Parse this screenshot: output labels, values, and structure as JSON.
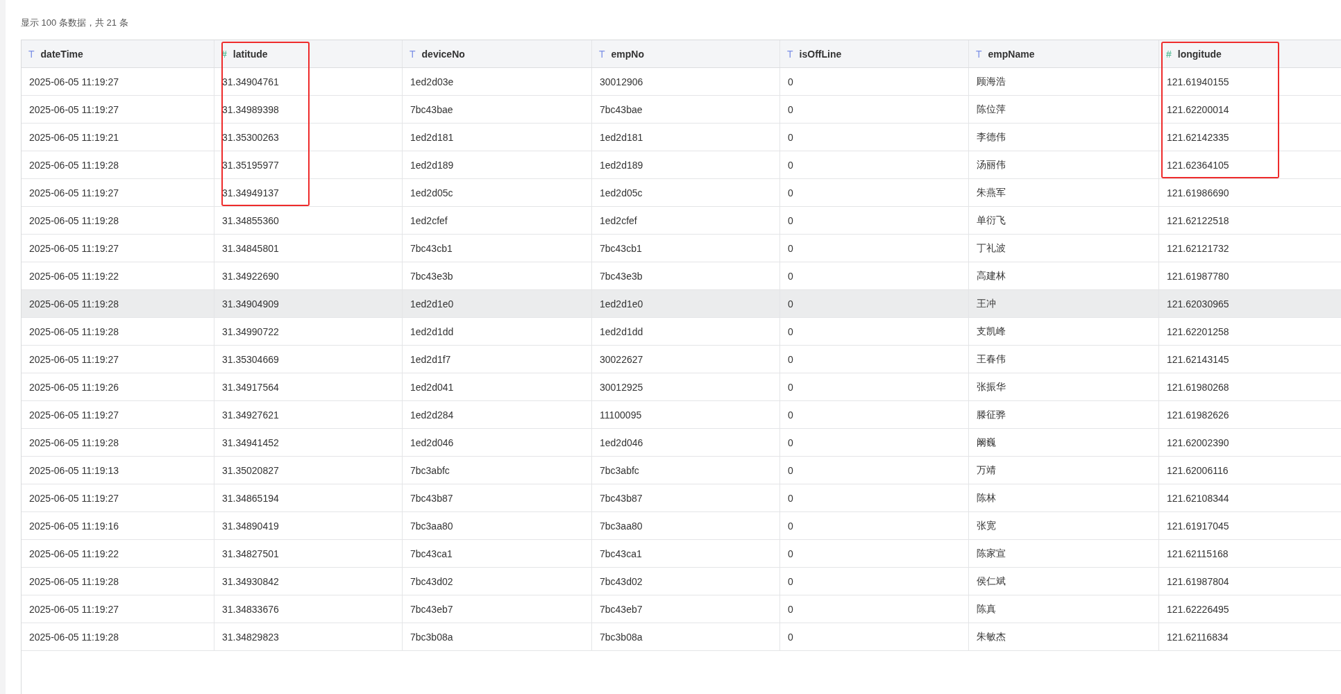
{
  "summary": "显示 100 条数据，共 21 条",
  "table": {
    "columns": [
      {
        "label": "dateTime",
        "kind": "text",
        "type_mark": "T"
      },
      {
        "label": "latitude",
        "kind": "number",
        "type_mark": "#"
      },
      {
        "label": "deviceNo",
        "kind": "text",
        "type_mark": "T"
      },
      {
        "label": "empNo",
        "kind": "text",
        "type_mark": "T"
      },
      {
        "label": "isOffLine",
        "kind": "text",
        "type_mark": "T"
      },
      {
        "label": "empName",
        "kind": "text",
        "type_mark": "T"
      },
      {
        "label": "longitude",
        "kind": "number",
        "type_mark": "#"
      }
    ],
    "rows": [
      {
        "cells": [
          "2025-06-05 11:19:27",
          "31.34904761",
          "1ed2d03e",
          "30012906",
          "0",
          "顾海浩",
          "121.61940155"
        ],
        "selected": false,
        "boxed": [
          false,
          true,
          false,
          false,
          false,
          false,
          true
        ]
      },
      {
        "cells": [
          "2025-06-05 11:19:27",
          "31.34989398",
          "7bc43bae",
          "7bc43bae",
          "0",
          "陈位萍",
          "121.62200014"
        ],
        "selected": false,
        "boxed": [
          false,
          true,
          false,
          false,
          false,
          false,
          true
        ]
      },
      {
        "cells": [
          "2025-06-05 11:19:21",
          "31.35300263",
          "1ed2d181",
          "1ed2d181",
          "0",
          "李德伟",
          "121.62142335"
        ],
        "selected": false,
        "boxed": [
          false,
          true,
          false,
          false,
          false,
          false,
          true
        ]
      },
      {
        "cells": [
          "2025-06-05 11:19:28",
          "31.35195977",
          "1ed2d189",
          "1ed2d189",
          "0",
          "汤丽伟",
          "121.62364105"
        ],
        "selected": false,
        "boxed": [
          false,
          true,
          false,
          false,
          false,
          false,
          true
        ]
      },
      {
        "cells": [
          "2025-06-05 11:19:27",
          "31.34949137",
          "1ed2d05c",
          "1ed2d05c",
          "0",
          "朱燕军",
          "121.61986690"
        ],
        "selected": false,
        "boxed": [
          false,
          true,
          false,
          false,
          false,
          false,
          false
        ]
      },
      {
        "cells": [
          "2025-06-05 11:19:28",
          "31.34855360",
          "1ed2cfef",
          "1ed2cfef",
          "0",
          "单衍飞",
          "121.62122518"
        ],
        "selected": false,
        "boxed": [
          false,
          false,
          false,
          false,
          false,
          false,
          false
        ]
      },
      {
        "cells": [
          "2025-06-05 11:19:27",
          "31.34845801",
          "7bc43cb1",
          "7bc43cb1",
          "0",
          "丁礼波",
          "121.62121732"
        ],
        "selected": false,
        "boxed": [
          false,
          false,
          false,
          false,
          false,
          false,
          false
        ]
      },
      {
        "cells": [
          "2025-06-05 11:19:22",
          "31.34922690",
          "7bc43e3b",
          "7bc43e3b",
          "0",
          "高建林",
          "121.61987780"
        ],
        "selected": false,
        "boxed": [
          false,
          false,
          false,
          false,
          false,
          false,
          false
        ]
      },
      {
        "cells": [
          "2025-06-05 11:19:28",
          "31.34904909",
          "1ed2d1e0",
          "1ed2d1e0",
          "0",
          "王冲",
          "121.62030965"
        ],
        "selected": true,
        "boxed": [
          false,
          false,
          false,
          false,
          false,
          false,
          false
        ]
      },
      {
        "cells": [
          "2025-06-05 11:19:28",
          "31.34990722",
          "1ed2d1dd",
          "1ed2d1dd",
          "0",
          "支凯峰",
          "121.62201258"
        ],
        "selected": false,
        "boxed": [
          false,
          false,
          false,
          false,
          false,
          false,
          false
        ]
      },
      {
        "cells": [
          "2025-06-05 11:19:27",
          "31.35304669",
          "1ed2d1f7",
          "30022627",
          "0",
          "王春伟",
          "121.62143145"
        ],
        "selected": false,
        "boxed": [
          false,
          false,
          false,
          false,
          false,
          false,
          false
        ]
      },
      {
        "cells": [
          "2025-06-05 11:19:26",
          "31.34917564",
          "1ed2d041",
          "30012925",
          "0",
          "张振华",
          "121.61980268"
        ],
        "selected": false,
        "boxed": [
          false,
          false,
          false,
          false,
          false,
          false,
          false
        ]
      },
      {
        "cells": [
          "2025-06-05 11:19:27",
          "31.34927621",
          "1ed2d284",
          "11100095",
          "0",
          "滕征骅",
          "121.61982626"
        ],
        "selected": false,
        "boxed": [
          false,
          false,
          false,
          false,
          false,
          false,
          false
        ]
      },
      {
        "cells": [
          "2025-06-05 11:19:28",
          "31.34941452",
          "1ed2d046",
          "1ed2d046",
          "0",
          "阚巍",
          "121.62002390"
        ],
        "selected": false,
        "boxed": [
          false,
          false,
          false,
          false,
          false,
          false,
          false
        ]
      },
      {
        "cells": [
          "2025-06-05 11:19:13",
          "31.35020827",
          "7bc3abfc",
          "7bc3abfc",
          "0",
          "万靖",
          "121.62006116"
        ],
        "selected": false,
        "boxed": [
          false,
          false,
          false,
          false,
          false,
          false,
          false
        ]
      },
      {
        "cells": [
          "2025-06-05 11:19:27",
          "31.34865194",
          "7bc43b87",
          "7bc43b87",
          "0",
          "陈林",
          "121.62108344"
        ],
        "selected": false,
        "boxed": [
          false,
          false,
          false,
          false,
          false,
          false,
          false
        ]
      },
      {
        "cells": [
          "2025-06-05 11:19:16",
          "31.34890419",
          "7bc3aa80",
          "7bc3aa80",
          "0",
          "张宽",
          "121.61917045"
        ],
        "selected": false,
        "boxed": [
          false,
          false,
          false,
          false,
          false,
          false,
          false
        ]
      },
      {
        "cells": [
          "2025-06-05 11:19:22",
          "31.34827501",
          "7bc43ca1",
          "7bc43ca1",
          "0",
          "陈家宣",
          "121.62115168"
        ],
        "selected": false,
        "boxed": [
          false,
          false,
          false,
          false,
          false,
          false,
          false
        ]
      },
      {
        "cells": [
          "2025-06-05 11:19:28",
          "31.34930842",
          "7bc43d02",
          "7bc43d02",
          "0",
          "侯仁斌",
          "121.61987804"
        ],
        "selected": false,
        "boxed": [
          false,
          false,
          false,
          false,
          false,
          false,
          false
        ]
      },
      {
        "cells": [
          "2025-06-05 11:19:27",
          "31.34833676",
          "7bc43eb7",
          "7bc43eb7",
          "0",
          "陈真",
          "121.62226495"
        ],
        "selected": false,
        "boxed": [
          false,
          false,
          false,
          false,
          false,
          false,
          false
        ]
      },
      {
        "cells": [
          "2025-06-05 11:19:28",
          "31.34829823",
          "7bc3b08a",
          "7bc3b08a",
          "0",
          "朱敏杰",
          "121.62116834"
        ],
        "selected": false,
        "boxed": [
          false,
          false,
          false,
          false,
          false,
          false,
          false
        ]
      }
    ]
  }
}
